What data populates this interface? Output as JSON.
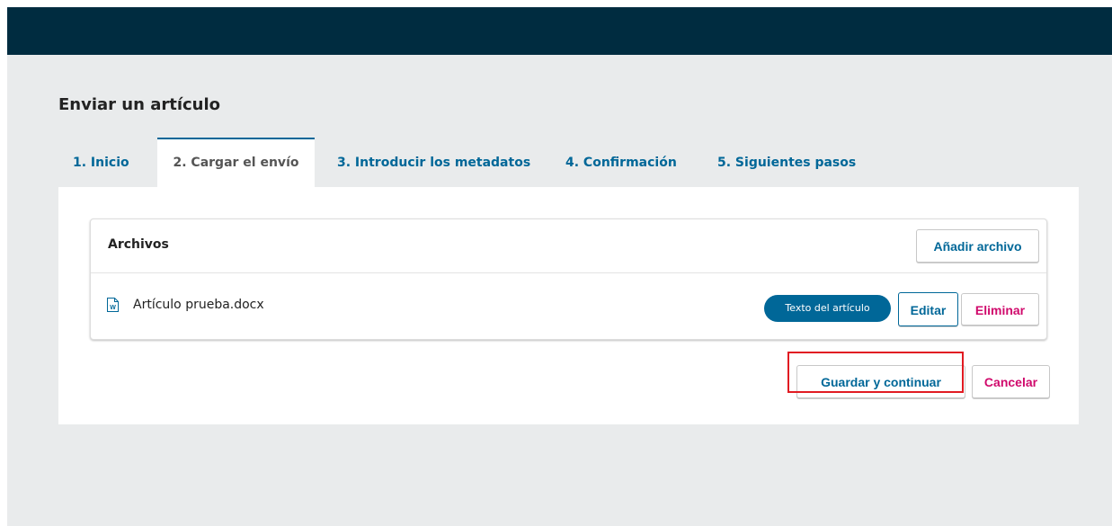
{
  "page": {
    "title": "Enviar un artículo"
  },
  "tabs": [
    {
      "label": "1. Inicio",
      "active": false
    },
    {
      "label": "2. Cargar el envío",
      "active": true
    },
    {
      "label": "3. Introducir los metadatos",
      "active": false
    },
    {
      "label": "4. Confirmación",
      "active": false
    },
    {
      "label": "5. Siguientes pasos",
      "active": false
    }
  ],
  "files_grid": {
    "title": "Archivos",
    "add_button": "Añadir archivo",
    "rows": [
      {
        "icon": "word-document-icon",
        "name": "Artículo prueba.docx",
        "type_badge": "Texto del artículo",
        "edit_label": "Editar",
        "delete_label": "Eliminar"
      }
    ]
  },
  "form_actions": {
    "save_label": "Guardar y continuar",
    "cancel_label": "Cancelar"
  },
  "colors": {
    "topbar": "#002c40",
    "link": "#006798",
    "danger": "#d00a6c",
    "highlight": "#e11b22"
  }
}
